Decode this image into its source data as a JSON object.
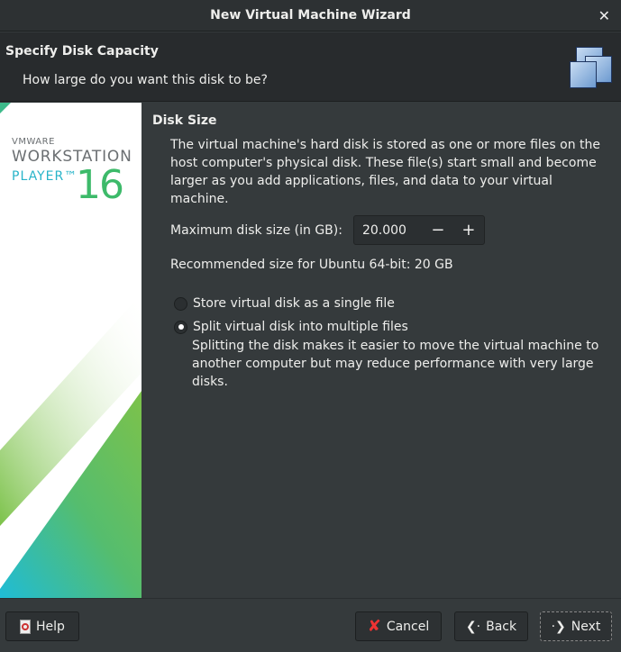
{
  "window": {
    "title": "New Virtual Machine Wizard",
    "close_glyph": "✕"
  },
  "header": {
    "title": "Specify Disk Capacity",
    "subtitle": "How large do you want this disk to be?"
  },
  "brand": {
    "vendor": "VMWARE",
    "product": "WORKSTATION",
    "edition": "PLAYER™",
    "version": "16"
  },
  "disk": {
    "section": "Disk Size",
    "description": "The virtual machine's hard disk is stored as one or more files on the host computer's physical disk. These file(s) start small and become larger as you add applications, files, and data to your virtual machine.",
    "max_label": "Maximum disk size (in GB):",
    "max_value": "20.000",
    "minus": "−",
    "plus": "+",
    "recommended": "Recommended size for Ubuntu 64-bit: 20 GB"
  },
  "options": [
    {
      "label": "Store virtual disk as a single file",
      "selected": false
    },
    {
      "label": "Split virtual disk into multiple files",
      "selected": true,
      "description": "Splitting the disk makes it easier to move the virtual machine to another computer but may reduce performance with very large disks."
    }
  ],
  "buttons": {
    "help": "Help",
    "cancel": "Cancel",
    "back": "Back",
    "next": "Next"
  }
}
